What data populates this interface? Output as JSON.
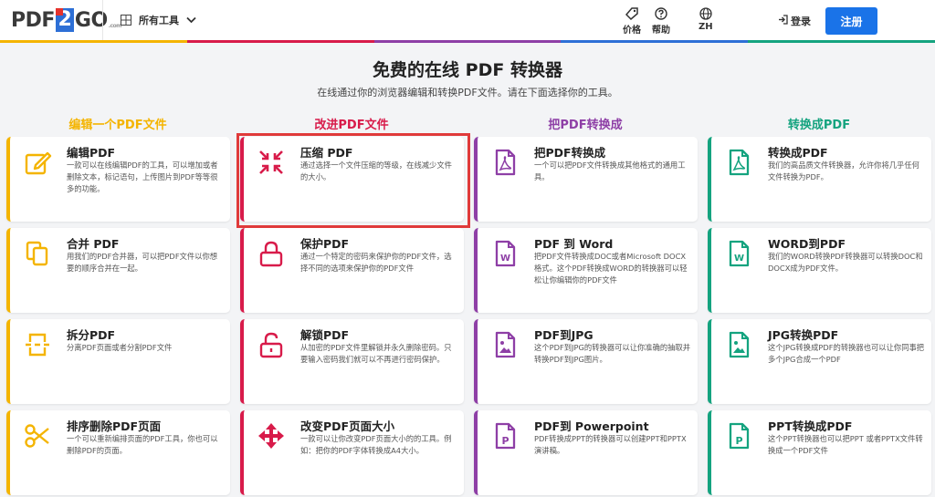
{
  "header": {
    "logo": {
      "left": "PDF",
      "mid": "2",
      "right": "GO",
      "suffix": ".com"
    },
    "tools_menu_label": "所有工具",
    "pricing_label": "价格",
    "help_label": "帮助",
    "lang_label": "ZH",
    "login_label": "登录",
    "signup_label": "注册"
  },
  "colors": {
    "edit": "#f4b400",
    "improve": "#d81b4a",
    "from_pdf": "#8e3fa6",
    "to_pdf": "#14a37f",
    "primary": "#1a73e8",
    "highlight": "#e03a3a"
  },
  "hero": {
    "title": "免费的在线 PDF 转换器",
    "subtitle": "在线通过你的浏览器编辑和转换PDF文件。请在下面选择你的工具。"
  },
  "columns": [
    {
      "heading": "编辑一个PDF文件",
      "cards": [
        {
          "title": "编辑PDF",
          "desc": "一款可以在线编辑PDF的工具，可以增加或者删除文本，标记语句，上传图片到PDF等等很多的功能。",
          "icon": "pencil-icon"
        },
        {
          "title": "合并 PDF",
          "desc": "用我们的PDF合并器，可以把PDF文件以你想要的顺序合并在一起。",
          "icon": "copy-icon"
        },
        {
          "title": "拆分PDF",
          "desc": "分离PDF页面或者分割PDF文件",
          "icon": "split-icon"
        },
        {
          "title": "排序删除PDF页面",
          "desc": "一个可以重新编排页面的PDF工具，你也可以删除PDF的页面。",
          "icon": "scissors-icon"
        }
      ]
    },
    {
      "heading": "改进PDF文件",
      "cards": [
        {
          "title": "压缩 PDF",
          "desc": "通过选择一个文件压缩的等级，在线减少文件的大小。",
          "icon": "compress-icon"
        },
        {
          "title": "保护PDF",
          "desc": "通过一个特定的密码来保护你的PDF文件，选择不同的选项来保护你的PDF文件",
          "icon": "lock-icon"
        },
        {
          "title": "解锁PDF",
          "desc": "从加密的PDF文件里解锁并永久删除密码。只要输入密码我们就可以不再进行密码保护。",
          "icon": "unlock-icon"
        },
        {
          "title": "改变PDF页面大小",
          "desc": "一款可以让你改变PDF页面大小的的工具。例如：把你的PDF字体转换成A4大小。",
          "icon": "move-arrows-icon"
        }
      ]
    },
    {
      "heading": "把PDF转换成",
      "cards": [
        {
          "title": "把PDF转换成",
          "desc": "一个可以把PDF文件转换成其他格式的通用工具。",
          "icon": "pdf-file-icon"
        },
        {
          "title": "PDF 到 Word",
          "desc": "把PDF文件转换成DOC或者Microsoft DOCX格式。这个PDF转换成WORD的转换器可以轻松让你编辑你的PDF文件",
          "icon": "word-file-icon"
        },
        {
          "title": "PDF到JPG",
          "desc": "这个PDF到JPG的转换器可以让你准确的抽取并转换PDF到JPG图片。",
          "icon": "image-file-icon"
        },
        {
          "title": "PDF到 Powerpoint",
          "desc": "PDF转换成PPT的转换器可以创建PPT和PPTX演讲稿。",
          "icon": "ppt-file-icon"
        }
      ]
    },
    {
      "heading": "转换成PDF",
      "cards": [
        {
          "title": "转换成PDF",
          "desc": "我们的高品质文件转换器，允许你将几乎任何文件转换为PDF。",
          "icon": "pdf-file-icon"
        },
        {
          "title": "WORD到PDF",
          "desc": "我们的WORD转换PDF转换器可以转换DOC和DOCX成为PDF文件。",
          "icon": "word-file-icon"
        },
        {
          "title": "JPG转换PDF",
          "desc": "这个JPG转换成PDF的转换器也可以让你同事把多个JPG合成一个PDF",
          "icon": "image-file-icon"
        },
        {
          "title": "PPT转换成PDF",
          "desc": "这个PPT转换器也可以把PPT 或者PPTX文件转换成一个PDF文件",
          "icon": "ppt-file-icon"
        }
      ]
    }
  ]
}
